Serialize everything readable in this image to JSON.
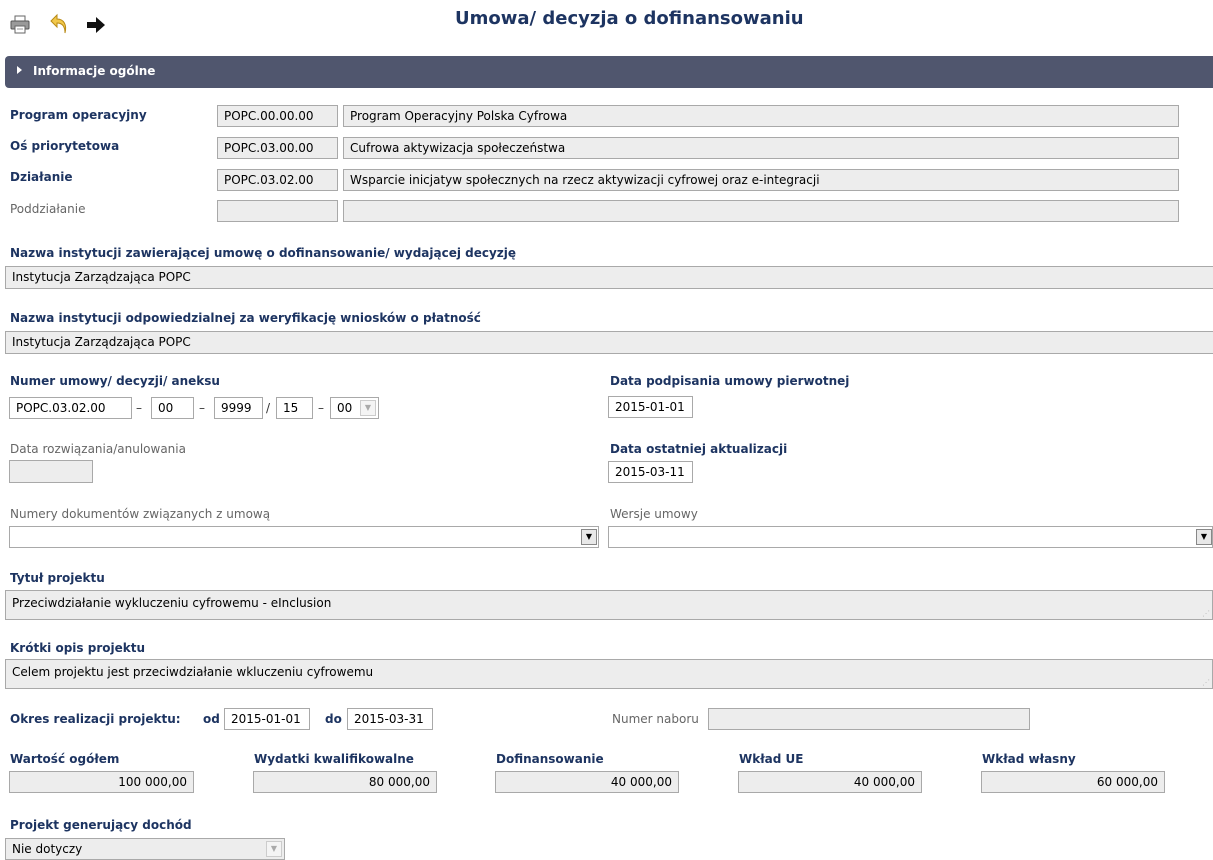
{
  "title": "Umowa/ decyzja o dofinansowaniu",
  "toolbar": {
    "print_icon": "printer-icon",
    "back_icon": "undo-arrow-icon",
    "next_icon": "right-arrow-icon"
  },
  "section": {
    "label": "Informacje ogólne",
    "color": "#50566e"
  },
  "program": {
    "label": "Program operacyjny",
    "code": "POPC.00.00.00",
    "name": "Program Operacyjny Polska Cyfrowa"
  },
  "axis": {
    "label": "Oś priorytetowa",
    "code": "POPC.03.00.00",
    "name": "Cufrowa aktywizacja społeczeństwa"
  },
  "action": {
    "label": "Działanie",
    "code": "POPC.03.02.00",
    "name": "Wsparcie inicjatyw społecznych na rzecz aktywizacji cyfrowej oraz e-integracji"
  },
  "subaction": {
    "label": "Poddziałanie",
    "code": "",
    "name": ""
  },
  "institution_contract": {
    "label": "Nazwa instytucji zawierającej umowę o dofinansowanie/ wydającej decyzję",
    "value": "Instytucja Zarządzająca POPC"
  },
  "institution_payment": {
    "label": "Nazwa instytucji odpowiedzialnej za weryfikację wniosków o płatność",
    "value": "Instytucja Zarządzająca POPC"
  },
  "contract_number": {
    "label": "Numer umowy/ decyzji/ aneksu",
    "part1": "POPC.03.02.00",
    "sep1": "–",
    "part2": "00",
    "sep2": "–",
    "part3": "9999",
    "sep3": "/",
    "part4": "15",
    "sep4": "–",
    "part5": "00"
  },
  "sign_date": {
    "label": "Data podpisania umowy pierwotnej",
    "value": "2015-01-01"
  },
  "termination_date": {
    "label": "Data rozwiązania/anulowania",
    "value": ""
  },
  "update_date": {
    "label": "Data ostatniej aktualizacji",
    "value": "2015-03-11"
  },
  "related_docs": {
    "label": "Numery dokumentów związanych z umową",
    "value": ""
  },
  "contract_versions": {
    "label": "Wersje umowy",
    "value": ""
  },
  "project_title": {
    "label": "Tytuł projektu",
    "value": "Przeciwdziałanie wykluczeniu cyfrowemu - eInclusion"
  },
  "project_desc": {
    "label": "Krótki opis projektu",
    "value": "Celem projektu jest przeciwdziałanie wkluczeniu cyfrowemu"
  },
  "period": {
    "label": "Okres realizacji projektu:",
    "from_label": "od",
    "from": "2015-01-01",
    "to_label": "do",
    "to": "2015-03-31"
  },
  "call_number": {
    "label": "Numer naboru",
    "value": ""
  },
  "values": [
    {
      "label": "Wartość ogółem",
      "value": "100 000,00"
    },
    {
      "label": "Wydatki kwalifikowalne",
      "value": "80 000,00"
    },
    {
      "label": "Dofinansowanie",
      "value": "40 000,00"
    },
    {
      "label": "Wkład UE",
      "value": "40 000,00"
    },
    {
      "label": "Wkład własny",
      "value": "60 000,00"
    }
  ],
  "income": {
    "label": "Projekt generujący dochód",
    "value": "Nie dotyczy"
  }
}
